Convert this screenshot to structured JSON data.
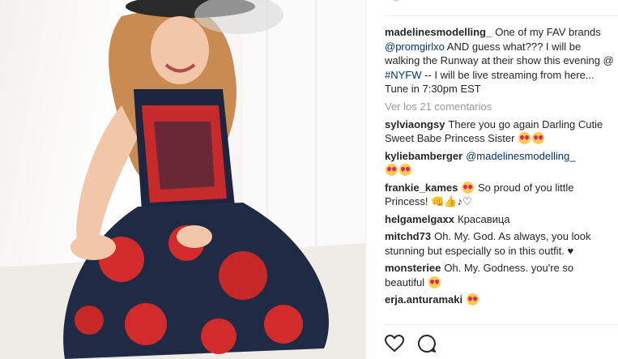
{
  "colors": {
    "username": "#262626",
    "link": "#003569",
    "muted": "#999999",
    "divider": "#efefef",
    "heart_emoji": "#e0245e"
  },
  "photo": {
    "alt_icon": "photo-content"
  },
  "caption": {
    "username": "madelinesmodelling_",
    "text_before_mention": "One of my FAV brands",
    "mention": "@promgirlxo",
    "text_before_tag": "AND guess what??? I will be walking the Runway at their show this evening @",
    "tag": "#NYFW",
    "text_after_tag": "-- I will be live streaming from here... Tune in 7:30pm EST"
  },
  "view_all_comments": "Ver los 21 comentarios",
  "comments": [
    {
      "username": "sylviaongsy",
      "text": "There you go again Darling Cutie Sweet Babe Princess Sister"
    },
    {
      "username": "kyliebamberger",
      "mention": "@madelinesmodelling_"
    },
    {
      "username": "frankie_kames",
      "text": "So proud of you little Princess!",
      "trail": "👊👍♪♡"
    },
    {
      "username": "helgamelgaxx",
      "text": "Красавица"
    },
    {
      "username": "mitchd73",
      "text": "Oh. My. God. As always, you look stunning but especially so in this outfit. ♥"
    },
    {
      "username": "monsteriee",
      "text": "Oh. My. Godness. you're so beautiful"
    },
    {
      "username": "erja.anturamaki",
      "text": ""
    }
  ],
  "actions": {
    "like_icon": "heart-icon",
    "comment_icon": "comment-icon"
  }
}
